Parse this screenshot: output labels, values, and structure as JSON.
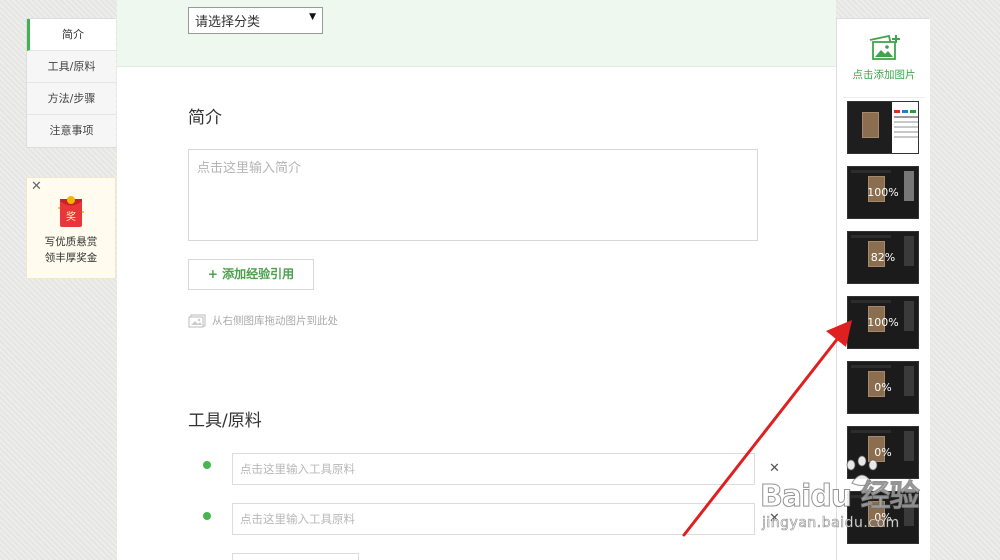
{
  "left_nav": {
    "items": [
      {
        "label": "简介",
        "active": true
      },
      {
        "label": "工具/原料",
        "active": false
      },
      {
        "label": "方法/步骤",
        "active": false
      },
      {
        "label": "注意事项",
        "active": false
      }
    ]
  },
  "reward": {
    "close_glyph": "✕",
    "icon_char": "奖",
    "line1": "写优质悬赏",
    "line2": "领丰厚奖金"
  },
  "editor": {
    "category_select": {
      "value": "请选择分类",
      "arrow": "▼"
    },
    "intro": {
      "title": "简介",
      "placeholder": "点击这里输入简介",
      "add_reference_label": "+ 添加经验引用",
      "drag_hint": "从右侧图库拖动图片到此处"
    },
    "tools": {
      "title": "工具/原料",
      "inputs": [
        {
          "placeholder": "点击这里输入工具原料"
        },
        {
          "placeholder": "点击这里输入工具原料"
        }
      ],
      "remove_glyph": "✕"
    }
  },
  "gallery": {
    "add_label": "点击添加图片",
    "thumbnails": [
      {
        "label": ""
      },
      {
        "label": "100%"
      },
      {
        "label": "82%"
      },
      {
        "label": "100%"
      },
      {
        "label": "0%"
      },
      {
        "label": "0%"
      },
      {
        "label": "0%"
      }
    ]
  },
  "watermark": {
    "logo": "Baidu 经验",
    "url": "jingyan.baidu.com"
  },
  "colors": {
    "accent_green": "#3fb34f",
    "arrow_red": "#e02020",
    "top_strip": "#eff8ef"
  }
}
